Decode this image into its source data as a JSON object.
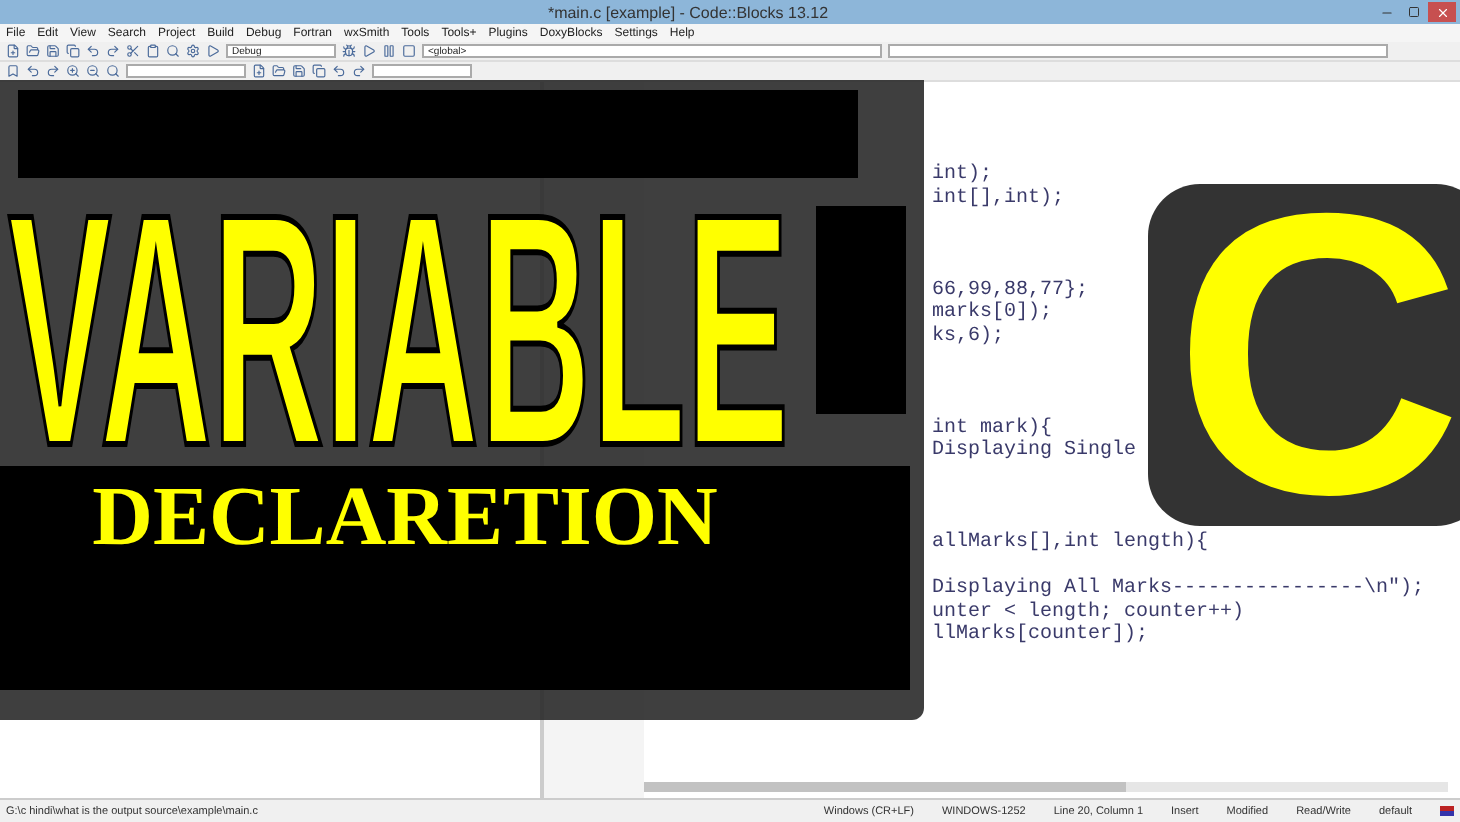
{
  "window": {
    "title": "*main.c [example] - Code::Blocks 13.12"
  },
  "menu": [
    "File",
    "Edit",
    "View",
    "Search",
    "Project",
    "Build",
    "Debug",
    "Fortran",
    "wxSmith",
    "Tools",
    "Tools+",
    "Plugins",
    "DoxyBlocks",
    "Settings",
    "Help"
  ],
  "toolbar": {
    "build_target": "Debug",
    "scope": "<global>"
  },
  "editor": {
    "lines": [
      {
        "kind": "code",
        "text": "int);"
      },
      {
        "kind": "code",
        "text": "int[],int);"
      },
      {
        "kind": "blank"
      },
      {
        "kind": "blank"
      },
      {
        "kind": "blank"
      },
      {
        "kind": "code",
        "text": "66,99,88,77};"
      },
      {
        "kind": "code",
        "text": "marks[0]);"
      },
      {
        "kind": "code",
        "text": "ks,6);"
      },
      {
        "kind": "blank"
      },
      {
        "kind": "blank"
      },
      {
        "kind": "blank"
      },
      {
        "kind": "code",
        "text": "int mark){"
      },
      {
        "kind": "code",
        "text": "Displaying Single"
      },
      {
        "kind": "blank"
      },
      {
        "kind": "blank"
      },
      {
        "kind": "blank"
      },
      {
        "kind": "code",
        "text": "allMarks[],int length){"
      },
      {
        "kind": "blank"
      },
      {
        "kind": "code",
        "text": "Displaying All Marks----------------\\n\");"
      },
      {
        "kind": "code",
        "text": "unter < length; counter++)"
      },
      {
        "kind": "code",
        "text": "llMarks[counter]);"
      }
    ]
  },
  "overlay": {
    "headline": "VARIABLE",
    "subtitle": "DECLARETION",
    "badge": "C"
  },
  "status_bar": {
    "path": "G:\\c hindi\\what is the output source\\example\\main.c",
    "items": [
      "Windows (CR+LF)",
      "WINDOWS-1252",
      "Line 20, Column 1",
      "Insert",
      "Modified",
      "Read/Write",
      "default"
    ]
  }
}
